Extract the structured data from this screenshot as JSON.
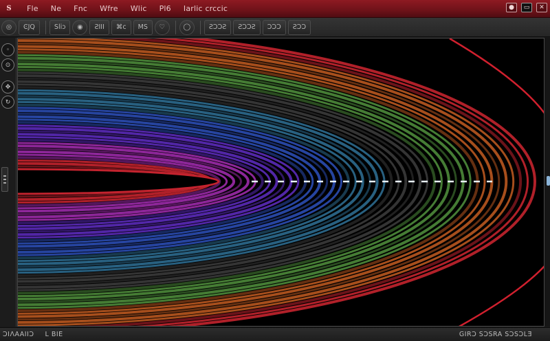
{
  "titlebar": {
    "logo": "S",
    "menu": [
      "Fle",
      "Ne",
      "Fnc",
      "Wfre",
      "Wlic",
      "Pl6",
      "Iarlic crccic"
    ]
  },
  "window_controls": {
    "icons": [
      "record-icon",
      "restore-icon",
      "close-icon"
    ]
  },
  "toolbar": {
    "buttons": [
      {
        "label": "◎",
        "icon": "target-icon"
      },
      {
        "label": "ϾJQ"
      },
      {
        "label": "Sliɔ"
      },
      {
        "label": "◉",
        "icon": "record-icon"
      },
      {
        "label": "ƧIII"
      },
      {
        "label": "⌘c"
      },
      {
        "label": "MS"
      },
      {
        "label": "♡",
        "icon": "heart-icon"
      },
      {
        "label": "◯",
        "icon": "circle-icon"
      },
      {
        "label": "ƧƆƆƧ"
      },
      {
        "label": "ƧƆƆƧ"
      },
      {
        "label": "ƆƆƆ"
      },
      {
        "label": "ƧƆƆ"
      }
    ]
  },
  "statusbar": {
    "left": "ƆIΛAAIIƆ",
    "mid": "L  BIE",
    "right": "GIRƆ  SƆSRA  SƆSƆLƎ"
  },
  "colors": {
    "titlebar": "#7a141c",
    "canvas_bg": "#000000",
    "bands": [
      "#c3232e",
      "#b8561f",
      "#4d8a3a",
      "#2c6a8e",
      "#2a4bb0",
      "#5a2ab8",
      "#9b2aa8",
      "#3a3a3a"
    ]
  }
}
